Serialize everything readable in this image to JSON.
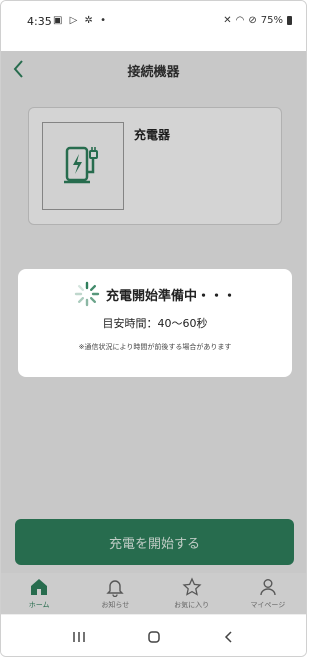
{
  "status_bar": {
    "time": "4:35",
    "left_icons": [
      "image-icon",
      "play-store-icon",
      "settings-icon",
      "dot-icon"
    ],
    "battery": "75%"
  },
  "header": {
    "title": "接続機器"
  },
  "device": {
    "name": "充電器",
    "icon": "ev-charger-icon"
  },
  "modal": {
    "title": "充電開始準備中・・・",
    "time_estimate": "目安時間：40〜60秒",
    "note": "※通信状況により時間が前後する場合があります"
  },
  "start_button": {
    "label": "充電を開始する"
  },
  "bottom_nav": {
    "items": [
      {
        "label": "ホーム",
        "icon": "home-icon",
        "active": true
      },
      {
        "label": "お知らせ",
        "icon": "bell-icon",
        "active": false
      },
      {
        "label": "お気に入り",
        "icon": "star-icon",
        "active": false
      },
      {
        "label": "マイページ",
        "icon": "person-icon",
        "active": false
      }
    ]
  },
  "colors": {
    "accent": "#2e7e5b",
    "background": "#e9e9e9"
  }
}
